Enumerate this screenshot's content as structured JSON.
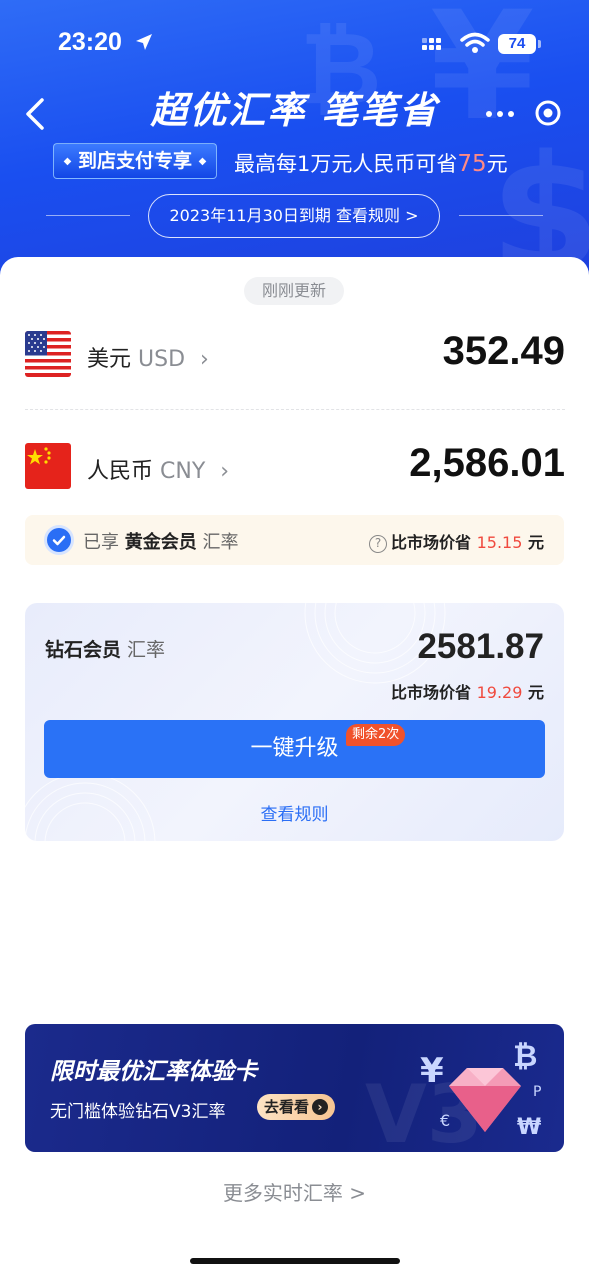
{
  "status_bar": {
    "time": "23:20",
    "battery": "74"
  },
  "header": {
    "title": "超优汇率 笔笔省",
    "promo_tag": "到店支付专享",
    "promo_text_prefix": "最高每1万元人民币可省",
    "promo_amount": "75",
    "promo_text_suffix": "元",
    "expire_text": "2023年11月30日到期 查看规则 >"
  },
  "rates": {
    "updated_label": "刚刚更新",
    "from": {
      "name": "美元",
      "code": "USD",
      "amount": "352.49"
    },
    "to": {
      "name": "人民币",
      "code": "CNY",
      "amount": "2,586.01"
    }
  },
  "gold": {
    "prefix": "已享",
    "tier": "黄金会员",
    "suffix": "汇率",
    "save_label": "比市场价省",
    "save_amount": "15.15",
    "save_unit": "元"
  },
  "diamond": {
    "tier": "钻石会员",
    "suffix": "汇率",
    "rate": "2581.87",
    "save_label": "比市场价省",
    "save_amount": "19.29",
    "save_unit": "元",
    "upgrade_label": "一键升级",
    "remain_badge": "剩余2次",
    "rules_label": "查看规则"
  },
  "banner": {
    "title": "限时最优汇率体验卡",
    "subtitle": "无门槛体验钻石V3汇率",
    "button": "去看看"
  },
  "more_rates": "更多实时汇率 >",
  "colors": {
    "brand_blue": "#2a72f6",
    "header_blue": "#1a4ff0",
    "accent_red": "#f04a3e"
  }
}
